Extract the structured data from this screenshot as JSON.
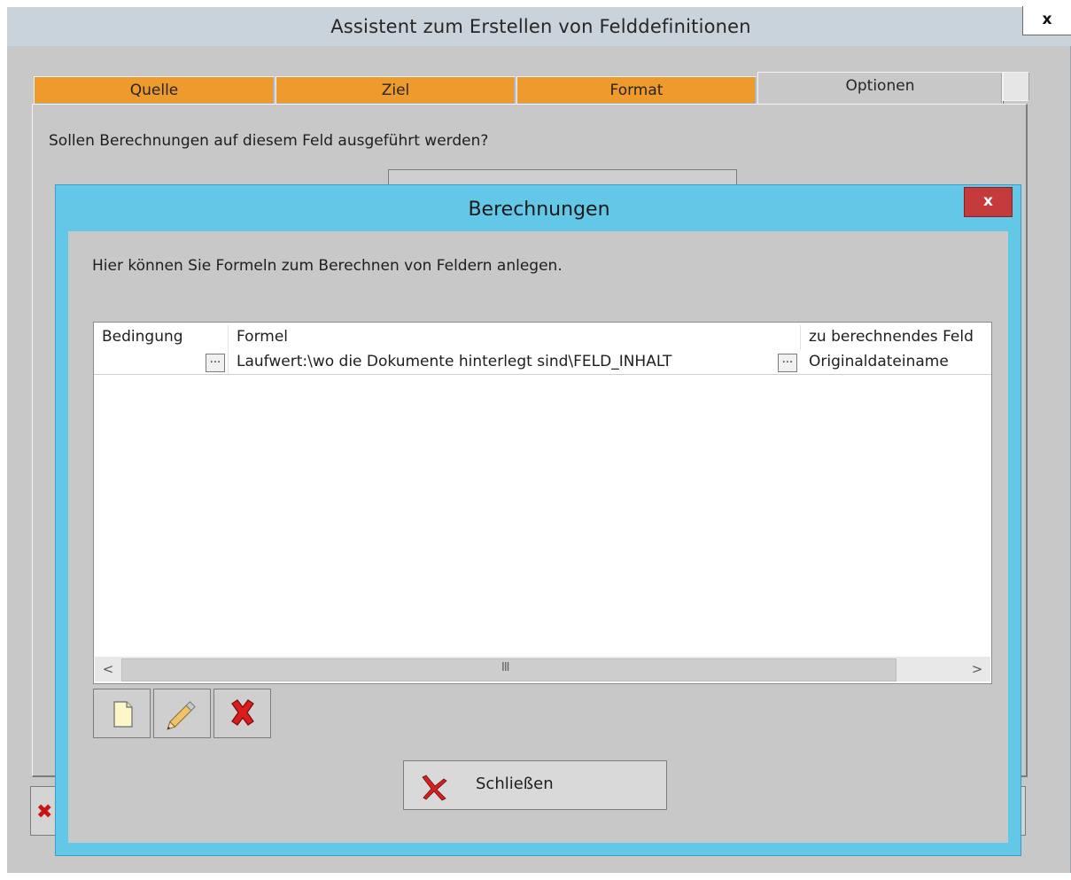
{
  "outer": {
    "title": "Assistent zum Erstellen von Felddefinitionen",
    "close_label": "x",
    "tabs": [
      {
        "label": "Quelle",
        "active": false
      },
      {
        "label": "Ziel",
        "active": false
      },
      {
        "label": "Format",
        "active": false
      },
      {
        "label": "Optionen",
        "active": true
      }
    ],
    "question": "Sollen Berechnungen auf diesem Feld ausgeführt werden?"
  },
  "modal": {
    "title": "Berechnungen",
    "close_label": "x",
    "intro": "Hier können Sie Formeln zum Berechnen von Feldern anlegen.",
    "grid": {
      "columns": [
        "Bedingung",
        "Formel",
        "zu berechnendes Feld"
      ],
      "rows": [
        {
          "bedingung": "",
          "formel": "Laufwert:\\wo die Dokumente hinterlegt sind\\FELD_INHALT",
          "feld": "Originaldateiname"
        }
      ],
      "ellipsis": "...",
      "scroll_left": "<",
      "scroll_right": ">",
      "scroll_grip": "III"
    },
    "toolbar": {
      "new_icon": "new-document-icon",
      "edit_icon": "pencil-icon",
      "delete_icon": "red-x-icon"
    },
    "close_button_label": "Schließen"
  },
  "colors": {
    "tab_orange": "#ee9a2d",
    "modal_frame": "#63c7e8",
    "modal_close": "#c53a3a",
    "window_gray": "#c8c8c8"
  }
}
